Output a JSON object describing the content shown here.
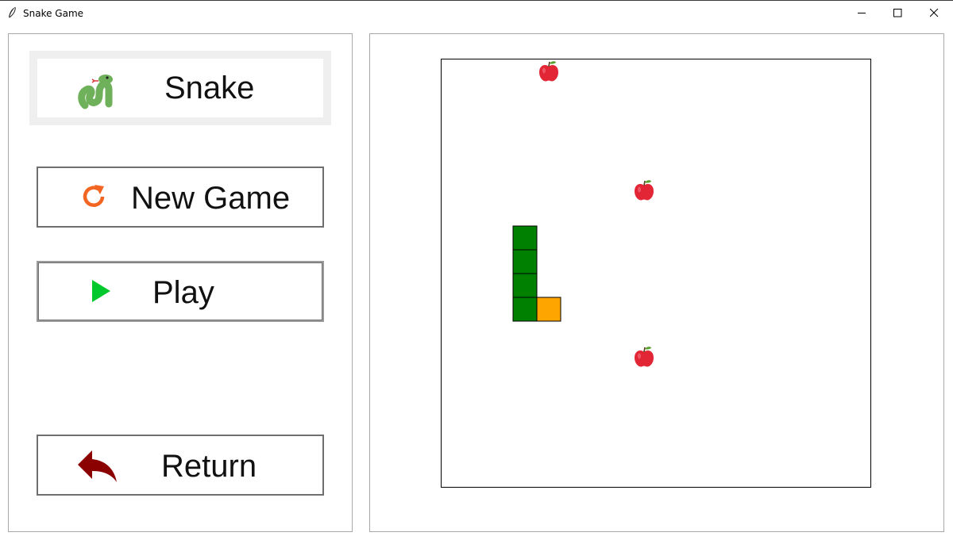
{
  "window": {
    "title": "Snake Game",
    "controls": [
      "minimize",
      "maximize",
      "close"
    ]
  },
  "sidebar": {
    "logo": {
      "label": "Snake",
      "icon": "snake-icon"
    },
    "buttons": [
      {
        "label": "New Game",
        "icon": "restart-icon",
        "icon_color": "#f26522"
      },
      {
        "label": "Play",
        "icon": "play-icon",
        "icon_color": "#00c82d"
      },
      {
        "label": "Return",
        "icon": "return-arrow-icon",
        "icon_color": "#8b0000"
      }
    ]
  },
  "game": {
    "grid_size": 18,
    "colors": {
      "body": "#008000",
      "head": "#ffa500",
      "apple": "#e32636",
      "leaf": "#5aa02c",
      "outline": "#000000"
    },
    "snake": [
      {
        "col": 3,
        "row": 7,
        "part": "body"
      },
      {
        "col": 3,
        "row": 8,
        "part": "body"
      },
      {
        "col": 3,
        "row": 9,
        "part": "body"
      },
      {
        "col": 3,
        "row": 10,
        "part": "body"
      },
      {
        "col": 4,
        "row": 10,
        "part": "head"
      }
    ],
    "apples": [
      {
        "col": 4,
        "row": 0
      },
      {
        "col": 8,
        "row": 5
      },
      {
        "col": 8,
        "row": 12
      }
    ]
  }
}
